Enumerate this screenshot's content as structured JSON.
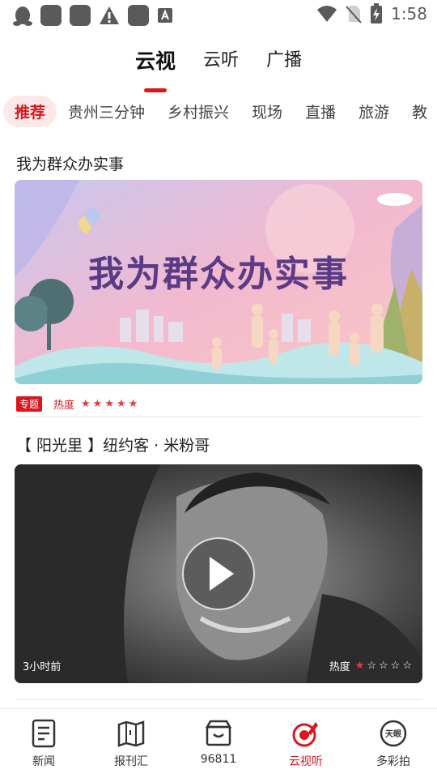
{
  "status_bar": {
    "time": "1:58",
    "icons": [
      "qq-penguin-icon",
      "app-square-icon",
      "app-square-icon",
      "warning-icon",
      "app-square-icon",
      "font-a-icon",
      "wifi-icon",
      "no-sim-icon",
      "battery-charging-icon"
    ]
  },
  "top_tabs": [
    {
      "label": "云视",
      "active": true
    },
    {
      "label": "云听",
      "active": false
    },
    {
      "label": "广播",
      "active": false
    }
  ],
  "categories": [
    {
      "label": "推荐",
      "active": true
    },
    {
      "label": "贵州三分钟",
      "active": false
    },
    {
      "label": "乡村振兴",
      "active": false
    },
    {
      "label": "现场",
      "active": false
    },
    {
      "label": "直播",
      "active": false
    },
    {
      "label": "旅游",
      "active": false
    },
    {
      "label": "教",
      "active": false
    }
  ],
  "feed": {
    "item1": {
      "title": "我为群众办实事",
      "banner_text": "我为群众办实事",
      "tag": "专题",
      "heat_label": "热度",
      "stars_filled": 5,
      "stars_total": 5
    },
    "item2": {
      "title": "【 阳光里 】纽约客 · 米粉哥",
      "time": "3小时前",
      "heat_label": "热度",
      "stars_filled": 1,
      "stars_total": 5
    }
  },
  "bottom_nav": [
    {
      "label": "新闻",
      "icon": "document-icon",
      "active": false
    },
    {
      "label": "报刊汇",
      "icon": "newspaper-map-icon",
      "active": false
    },
    {
      "label": "96811",
      "icon": "store-icon",
      "active": false
    },
    {
      "label": "云视听",
      "icon": "radar-note-icon",
      "active": true
    },
    {
      "label": "多彩拍",
      "icon": "camera-stamp-icon",
      "active": false
    }
  ],
  "colors": {
    "accent": "#d8181e",
    "chip_bg": "#fde8e8"
  }
}
